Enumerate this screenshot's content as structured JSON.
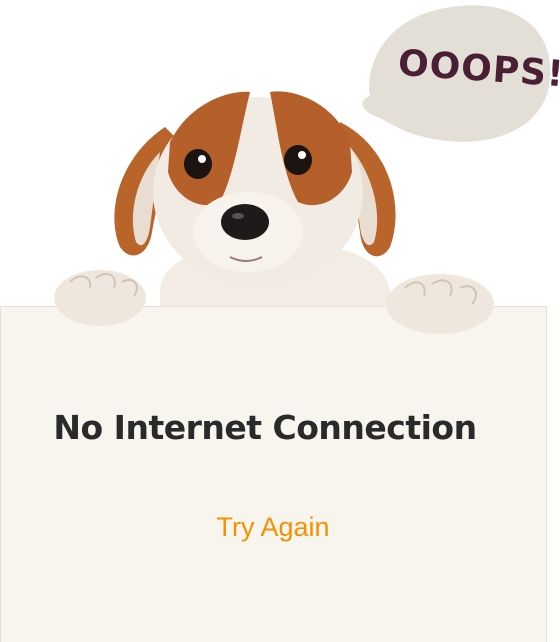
{
  "bubble": {
    "text": "OOOPS!"
  },
  "message": {
    "title": "No Internet Connection"
  },
  "actions": {
    "retry_label": "Try Again"
  },
  "colors": {
    "accent": "#f39200",
    "title": "#2a2a2a",
    "bubble_fill": "#e3dfd6",
    "bubble_text": "#4a1f33",
    "card_bg": "#f8f5ef"
  },
  "images": {
    "illustration": "puppy-peeking-over-sign"
  }
}
